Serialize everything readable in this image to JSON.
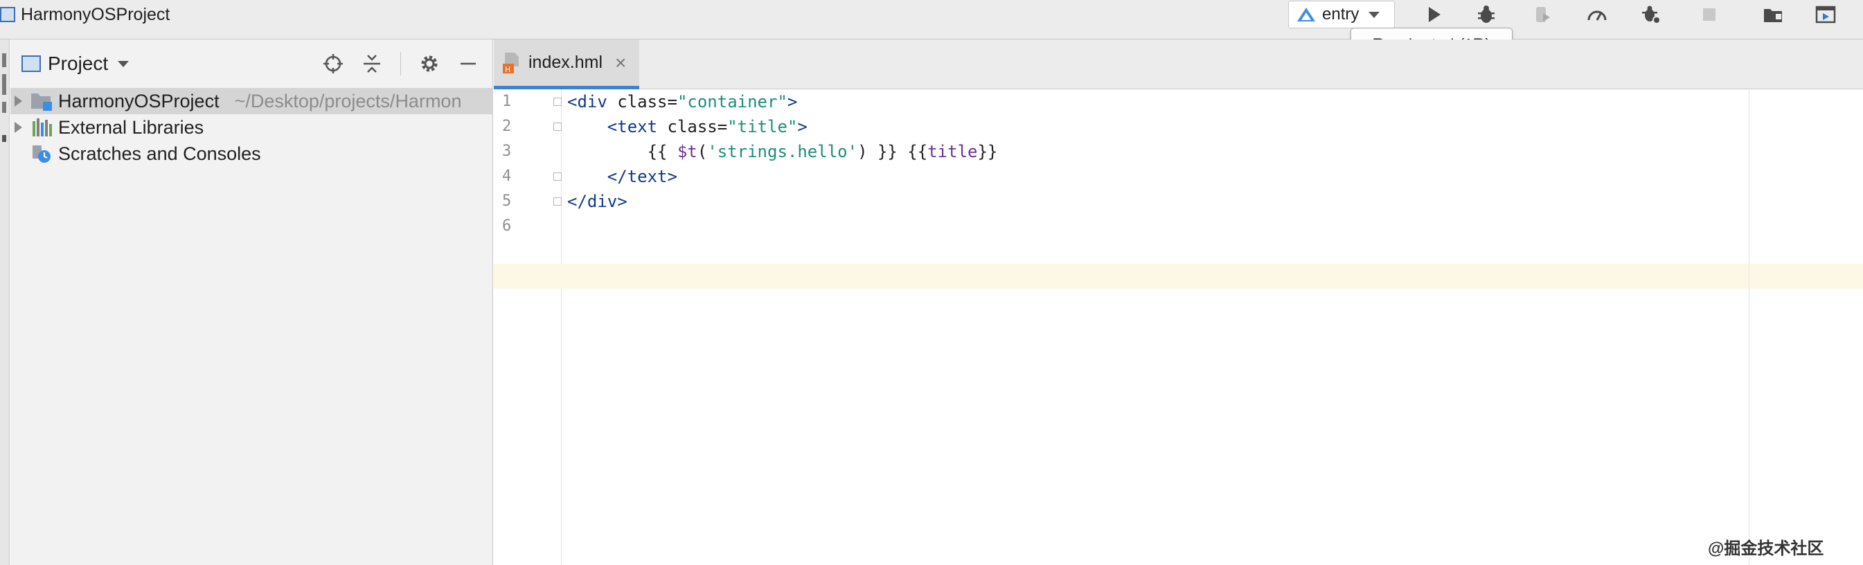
{
  "window": {
    "title": "HarmonyOSProject"
  },
  "toolbar": {
    "run_config": "entry",
    "tooltip": "Run 'entry' (^R)",
    "icons": [
      "run-icon",
      "debug-icon",
      "attach-debugger-icon",
      "profile-icon",
      "debug-settings-icon",
      "stop-icon",
      "project-structure-icon",
      "device-manager-icon"
    ]
  },
  "project_panel": {
    "title": "Project",
    "items": [
      {
        "label": "HarmonyOSProject",
        "path": "~/Desktop/projects/Harmon",
        "icon": "project-folder-icon",
        "expandable": true,
        "selected": true
      },
      {
        "label": "External Libraries",
        "icon": "libraries-icon",
        "expandable": true,
        "selected": false
      },
      {
        "label": "Scratches and Consoles",
        "icon": "scratches-icon",
        "expandable": false,
        "selected": false
      }
    ]
  },
  "editor": {
    "tab": {
      "name": "index.hml",
      "icon": "hml-file-icon"
    },
    "line_numbers": [
      "1",
      "2",
      "3",
      "4",
      "5",
      "6"
    ],
    "lines": [
      [
        {
          "t": "<div ",
          "c": "tag"
        },
        {
          "t": "class",
          "c": "attr"
        },
        {
          "t": "=",
          "c": "eq"
        },
        {
          "t": "\"container\"",
          "c": "str"
        },
        {
          "t": ">",
          "c": "tag"
        }
      ],
      [
        {
          "t": "    <text ",
          "c": "tag"
        },
        {
          "t": "class",
          "c": "attr"
        },
        {
          "t": "=",
          "c": "eq"
        },
        {
          "t": "\"title\"",
          "c": "str"
        },
        {
          "t": ">",
          "c": "tag"
        }
      ],
      [
        {
          "t": "        {{ ",
          "c": "plain"
        },
        {
          "t": "$t",
          "c": "fn"
        },
        {
          "t": "(",
          "c": "punct"
        },
        {
          "t": "'strings.hello'",
          "c": "sstr"
        },
        {
          "t": ") }} {{",
          "c": "plain"
        },
        {
          "t": "title",
          "c": "var"
        },
        {
          "t": "}}",
          "c": "plain"
        }
      ],
      [
        {
          "t": "    </text>",
          "c": "tag"
        }
      ],
      [
        {
          "t": "</div>",
          "c": "tag"
        }
      ],
      []
    ]
  },
  "watermark": "@掘金技术社区"
}
